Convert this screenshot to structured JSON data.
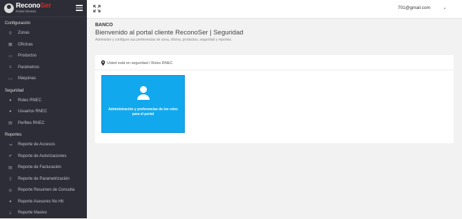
{
  "brand": {
    "title_main": "Recono",
    "title_accent": "Ser",
    "subtitle": "Portal Clientes"
  },
  "sidebar": {
    "sections": [
      {
        "label": "Configuración",
        "items": [
          {
            "label": "Zonas",
            "icon": "map-pin-icon"
          },
          {
            "label": "Oficinas",
            "icon": "building-icon"
          },
          {
            "label": "Productos",
            "icon": "box-icon"
          },
          {
            "label": "Parámetros",
            "icon": "sliders-icon"
          },
          {
            "label": "Máquinas",
            "icon": "laptop-icon"
          }
        ]
      },
      {
        "label": "Seguridad",
        "items": [
          {
            "label": "Roles RNEC",
            "icon": "users-icon"
          },
          {
            "label": "Usuarios RNEC",
            "icon": "user-group-icon"
          },
          {
            "label": "Perfiles RNEC",
            "icon": "id-card-icon"
          }
        ]
      },
      {
        "label": "Reportes",
        "items": [
          {
            "label": "Reporte de Accesos",
            "icon": "login-icon"
          },
          {
            "label": "Reporte de Autorizaciones",
            "icon": "check-icon"
          },
          {
            "label": "Reporte de Facturación",
            "icon": "invoice-icon"
          },
          {
            "label": "Reporte de Parametrización",
            "icon": "document-icon"
          },
          {
            "label": "Reporte Resumen de Consulta",
            "icon": "database-icon"
          },
          {
            "label": "Reporte Asesores No Hit",
            "icon": "user-alert-icon"
          },
          {
            "label": "Reporte Masivo",
            "icon": "download-icon"
          }
        ]
      }
    ]
  },
  "topbar": {
    "user_email": "701@gmail.com"
  },
  "header": {
    "bank_name": "BANCO",
    "welcome": "Bienvenido al portal cliente ReconoSer | Seguridad",
    "subtitle": "Administre y configure sus preferencias de zona, oficina, productos, seguridad y reportes."
  },
  "card": {
    "breadcrumb": "Usted está en seguridad / Roles RNEC",
    "tile_label": "Administración y preferencias de los roles para el portal"
  },
  "colors": {
    "sidebar_bg": "#2c2d36",
    "brand_accent": "#e2231a",
    "tile_bg": "#12a8ee"
  }
}
